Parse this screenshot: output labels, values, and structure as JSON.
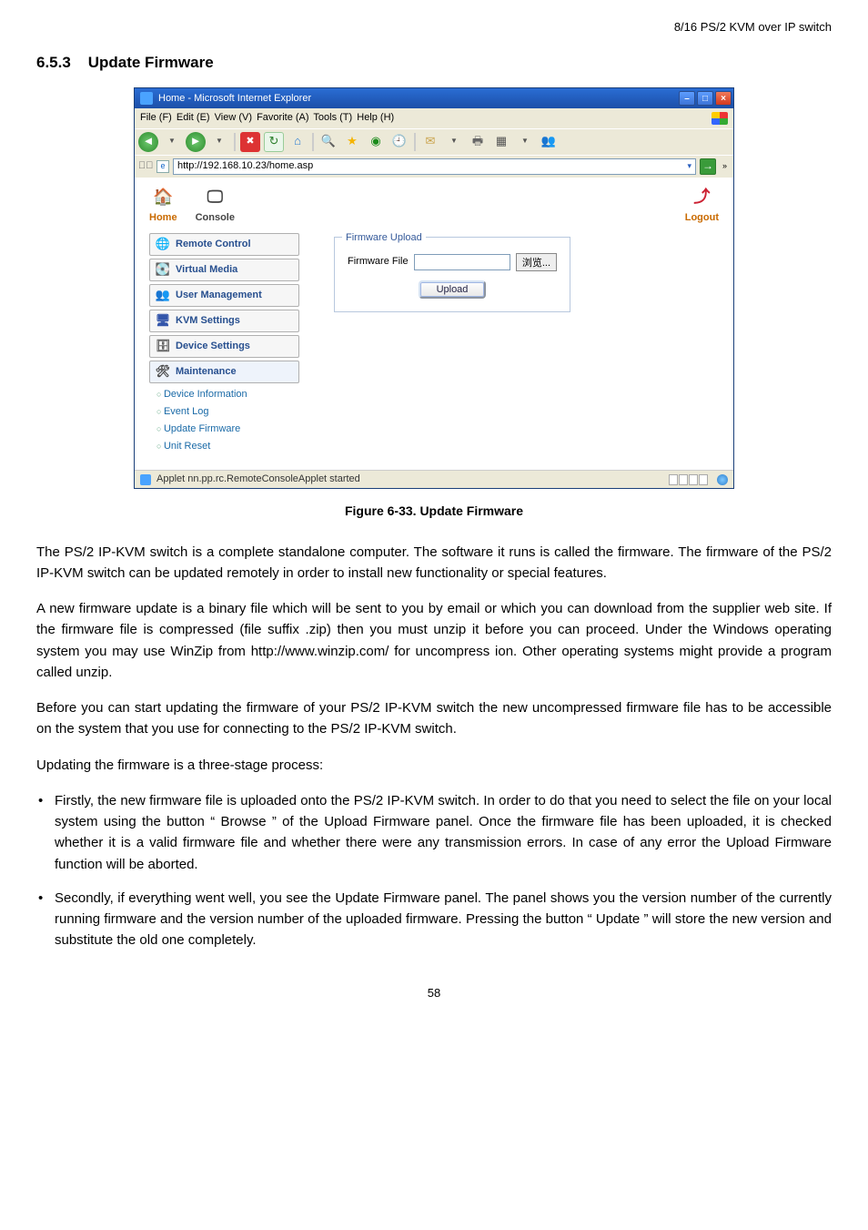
{
  "page": {
    "header_right": "8/16 PS/2 KVM over IP switch",
    "section_number": "6.5.3",
    "section_title": "Update Firmware",
    "figure_caption": "Figure 6-33. Update Firmware",
    "page_number": "58"
  },
  "ie": {
    "title": "Home - Microsoft Internet Explorer",
    "menu": {
      "file": "File (F)",
      "edit": "Edit (E)",
      "view": "View (V)",
      "favorite": "Favorite (A)",
      "tools": "Tools (T)",
      "help": "Help (H)"
    },
    "address_url": "http://192.168.10.23/home.asp",
    "status_text": "Applet nn.pp.rc.RemoteConsoleApplet started",
    "addr_chevrons": "»"
  },
  "app": {
    "nav": {
      "home": "Home",
      "console": "Console",
      "logout": "Logout"
    },
    "sidebar": {
      "remote_control": "Remote Control",
      "virtual_media": "Virtual Media",
      "user_management": "User Management",
      "kvm_settings": "KVM Settings",
      "device_settings": "Device Settings",
      "maintenance": "Maintenance",
      "sub": {
        "device_information": "Device Information",
        "event_log": "Event Log",
        "update_firmware": "Update Firmware",
        "unit_reset": "Unit Reset"
      }
    },
    "panel": {
      "legend": "Firmware Upload",
      "file_label": "Firmware File",
      "browse": "浏览...",
      "upload": "Upload"
    }
  },
  "text": {
    "p1": "The PS/2 IP-KVM switch is a complete standalone computer. The software it runs is called the firmware. The firmware of the PS/2 IP-KVM switch can be updated remotely in order to install new functionality or special features.",
    "p2": "A new firmware update is a binary file which will be sent to you by email or which you can download from the supplier web site. If the firmware file is compressed (file suffix .zip) then you must unzip it before you can proceed. Under the Windows operating system you may use WinZip from http://www.winzip.com/ for uncompress ion. Other operating systems might provide a program called unzip.",
    "p3": "Before you can start updating the firmware of your PS/2 IP-KVM switch the new uncompressed firmware file has to be accessible on the system that you use for connecting to the PS/2 IP-KVM switch.",
    "p4": "Updating the firmware is a three-stage process:",
    "b1": "Firstly, the new firmware file is uploaded onto the PS/2 IP-KVM switch. In order to do that you need to select the file on your local system using the button “ Browse ” of the Upload Firmware panel. Once the firmware file has been uploaded, it is checked whether it is a valid firmware file and whether there were any transmission errors. In case of any error the Upload Firmware function will be aborted.",
    "b2": "Secondly, if everything went well, you see the Update Firmware panel. The panel shows you the version number of the currently running firmware and the version number of the uploaded firmware. Pressing the button “ Update ” will store the new version and substitute the old one completely."
  }
}
